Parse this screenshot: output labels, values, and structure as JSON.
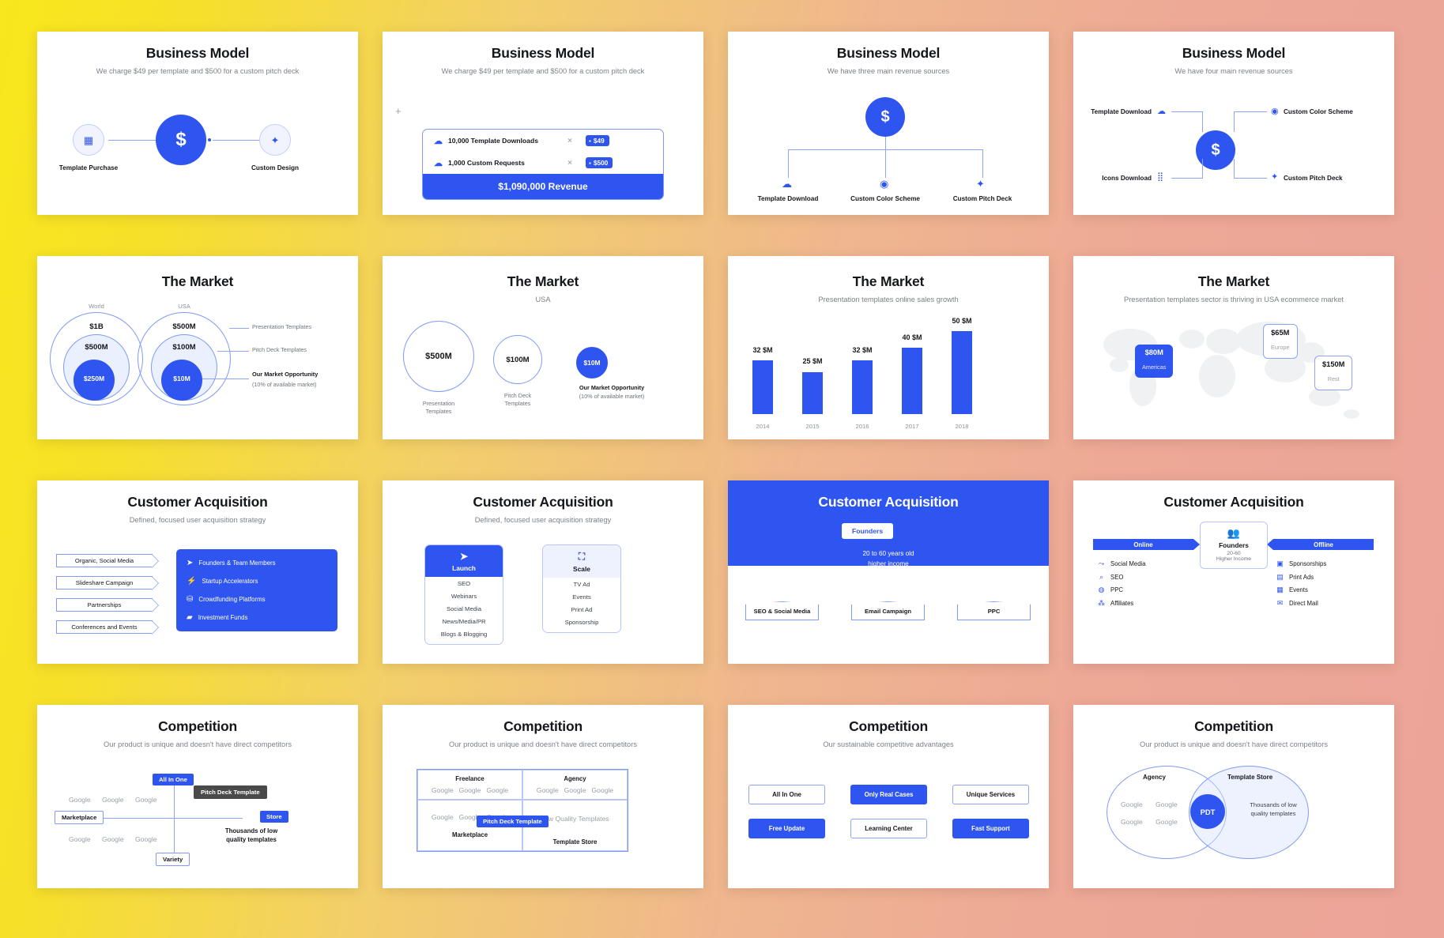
{
  "slides": [
    {
      "id": "business-model-1",
      "title": "Business Model",
      "subtitle": "We charge $49 per template and $500 for a custom pitch deck",
      "nodes": [
        {
          "label": "Template Purchase",
          "icon": "table-icon"
        },
        {
          "label": "",
          "icon": "dollar-icon"
        },
        {
          "label": "Custom Design",
          "icon": "magic-wand-icon"
        }
      ]
    },
    {
      "id": "business-model-2",
      "title": "Business Model",
      "subtitle": "We charge $49 per template and $500 for a custom pitch deck",
      "plus": "+",
      "rows": [
        {
          "icon": "cloud-icon",
          "label": "10,000 Template Downloads",
          "operator": "×",
          "price": "$49"
        },
        {
          "icon": "cloud-icon",
          "label": "1,000 Custom Requests",
          "operator": "×",
          "price": "$500"
        }
      ],
      "total": "$1,090,000 Revenue"
    },
    {
      "id": "business-model-3",
      "title": "Business Model",
      "subtitle": "We have three main revenue sources",
      "center_icon": "dollar-icon",
      "sources": [
        {
          "label": "Template Download",
          "icon": "cloud-icon"
        },
        {
          "label": "Custom Color Scheme",
          "icon": "palette-icon"
        },
        {
          "label": "Custom Pitch Deck",
          "icon": "magic-wand-icon"
        }
      ]
    },
    {
      "id": "business-model-4",
      "title": "Business Model",
      "subtitle": "We have four main revenue sources",
      "center_icon": "dollar-icon",
      "sources": [
        {
          "label": "Template Download",
          "icon": "cloud-icon"
        },
        {
          "label": "Custom Color Scheme",
          "icon": "palette-icon"
        },
        {
          "label": "Icons Download",
          "icon": "grid-icon"
        },
        {
          "label": "Custom Pitch Deck",
          "icon": "magic-wand-icon"
        }
      ]
    },
    {
      "id": "market-1",
      "title": "The Market",
      "subtitle": "",
      "groups": [
        {
          "caption": "World",
          "values": [
            "$1B",
            "$500M",
            "$250M"
          ]
        },
        {
          "caption": "USA",
          "values": [
            "$500M",
            "$100M",
            "$10M"
          ]
        }
      ],
      "legend": [
        "Presentation Templates",
        "Pitch Deck Templates",
        "Our Market Opportunity",
        "(10% of available market)"
      ]
    },
    {
      "id": "market-2",
      "title": "The Market",
      "subtitle": "USA",
      "circles": [
        {
          "value": "$500M",
          "caption": "Presentation\nTemplates",
          "filled": false
        },
        {
          "value": "$100M",
          "caption": "Pitch Deck\nTemplates",
          "filled": false
        },
        {
          "value": "$10M",
          "caption": "Our Market Opportunity\n(10% of available market)",
          "filled": true
        }
      ]
    },
    {
      "id": "market-3",
      "title": "The Market",
      "subtitle": "Presentation templates online sales growth",
      "chart_data": {
        "type": "bar",
        "title": "Presentation templates online sales growth",
        "categories": [
          "2014",
          "2015",
          "2016",
          "2017",
          "2018"
        ],
        "values": [
          32,
          25,
          32,
          40,
          50
        ],
        "value_labels": [
          "32 $M",
          "25 $M",
          "32 $M",
          "40 $M",
          "50 $M"
        ],
        "xlabel": "",
        "ylabel": "",
        "ylim": [
          0,
          55
        ],
        "grid": false,
        "legend": "none",
        "bar_color": "#2f55f0"
      }
    },
    {
      "id": "market-4",
      "title": "The Market",
      "subtitle": "Presentation templates sector is thriving in USA ecommerce market",
      "regions": [
        {
          "value": "$80M",
          "name": "Americas",
          "filled": true
        },
        {
          "value": "$65M",
          "name": "Europe",
          "filled": false
        },
        {
          "value": "$150M",
          "name": "Rest",
          "filled": false
        }
      ]
    },
    {
      "id": "acquisition-1",
      "title": "Customer Acquisition",
      "subtitle": "Defined, focused user acquisition strategy",
      "channels": [
        "Organic, Social Media",
        "Slideshare Campaign",
        "Partnerships",
        "Conferences and Events"
      ],
      "panel": [
        {
          "icon": "pin-icon",
          "label": "Founders & Team Members"
        },
        {
          "icon": "bolt-icon",
          "label": "Startup Accelerators"
        },
        {
          "icon": "hand-coin-icon",
          "label": "Crowdfunding Platforms"
        },
        {
          "icon": "briefcase-icon",
          "label": "Investment Funds"
        }
      ]
    },
    {
      "id": "acquisition-2",
      "title": "Customer Acquisition",
      "subtitle": "Defined, focused user acquisition strategy",
      "columns": [
        {
          "head": "Launch",
          "icon": "paper-plane-icon",
          "items": [
            "SEO",
            "Webinars",
            "Social Media",
            "News/Media/PR",
            "Blogs & Blogging"
          ]
        },
        {
          "head": "Scale",
          "icon": "expand-icon",
          "items": [
            "TV Ad",
            "Events",
            "Print Ad",
            "Sponsorship"
          ]
        }
      ]
    },
    {
      "id": "acquisition-3",
      "title": "Customer Acquisition",
      "chip": "Founders",
      "desc_line1": "20 to 60 years old",
      "desc_line2": "higher income",
      "tiles": [
        "SEO & Social Media",
        "Email Campaign",
        "PPC"
      ]
    },
    {
      "id": "acquisition-4",
      "title": "Customer Acquisition",
      "subtitle": "",
      "online_label": "Online",
      "offline_label": "Offline",
      "center": {
        "title": "Founders",
        "line1": "20-60",
        "line2": "Higher Income",
        "icon": "users-icon"
      },
      "online": [
        {
          "icon": "share-icon",
          "label": "Social Media"
        },
        {
          "icon": "search-icon",
          "label": "SEO"
        },
        {
          "icon": "coin-icon",
          "label": "PPC"
        },
        {
          "icon": "affiliates-icon",
          "label": "Affiliates"
        }
      ],
      "offline": [
        {
          "icon": "megaphone-icon",
          "label": "Sponsorships"
        },
        {
          "icon": "book-icon",
          "label": "Print Ads"
        },
        {
          "icon": "calendar-icon",
          "label": "Events"
        },
        {
          "icon": "mail-icon",
          "label": "Direct Mail"
        }
      ]
    },
    {
      "id": "competition-1",
      "title": "Competition",
      "subtitle": "Our product is unique and doesn't have direct competitors",
      "axis": {
        "top": "All In One",
        "bottom": "Variety",
        "left": "Marketplace",
        "right": "Store"
      },
      "product": "Pitch Deck Template",
      "note": "Thousands of low\nquality templates",
      "competitors": [
        "Google",
        "Google",
        "Google",
        "Google",
        "Google",
        "Google"
      ]
    },
    {
      "id": "competition-2",
      "title": "Competition",
      "subtitle": "Our product is unique and doesn't have direct competitors",
      "headers": [
        "Freelance",
        "Agency"
      ],
      "footers": [
        "Marketplace",
        "Template Store"
      ],
      "product": "Pitch Deck Template",
      "cell_note": "Low Quality Templates",
      "competitors": [
        "Google",
        "Google",
        "Google"
      ]
    },
    {
      "id": "competition-3",
      "title": "Competition",
      "subtitle": "Our sustainable competitive advantages",
      "buttons": [
        {
          "label": "All In One",
          "style": "white"
        },
        {
          "label": "Only Real Cases",
          "style": "blue"
        },
        {
          "label": "Unique Services",
          "style": "white"
        },
        {
          "label": "Free Update",
          "style": "blue"
        },
        {
          "label": "Learning Center",
          "style": "white"
        },
        {
          "label": "Fast Support",
          "style": "blue"
        }
      ]
    },
    {
      "id": "competition-4",
      "title": "Competition",
      "subtitle": "Our product is unique and doesn't have direct competitors",
      "left_label": "Agency",
      "right_label": "Template Store",
      "center_label": "PDT",
      "note": "Thousands of low\nquality templates",
      "competitors": [
        "Google",
        "Google",
        "Google",
        "Google"
      ]
    }
  ],
  "colors": {
    "accent": "#2f55f0",
    "dark": "#15171c",
    "muted": "#8a8f99",
    "pale": "#eef2fe",
    "gray_tag": "#4a4a4a"
  }
}
